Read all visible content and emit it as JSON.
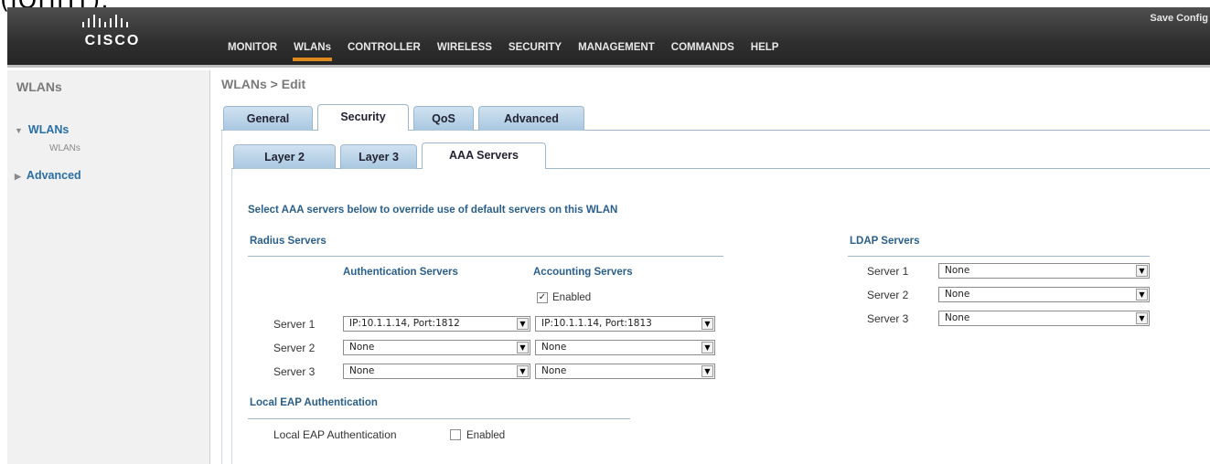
{
  "fragment_text": "(IOHHT).",
  "header": {
    "logo_word": "CISCO",
    "save_link": "Save Config",
    "nav": [
      "MONITOR",
      "WLANs",
      "CONTROLLER",
      "WIRELESS",
      "SECURITY",
      "MANAGEMENT",
      "COMMANDS",
      "HELP"
    ],
    "active_nav": "WLANs"
  },
  "sidebar": {
    "title": "WLANs",
    "items": [
      {
        "label": "WLANs",
        "expanded": true
      },
      {
        "label": "Advanced",
        "expanded": false
      }
    ],
    "sub_items": [
      "WLANs"
    ]
  },
  "page": {
    "title": "WLANs > Edit",
    "tabs": [
      "General",
      "Security",
      "QoS",
      "Advanced"
    ],
    "active_tab": "Security",
    "sub_tabs": [
      "Layer 2",
      "Layer 3",
      "AAA Servers"
    ],
    "active_sub_tab": "AAA Servers",
    "instruction": "Select AAA servers below to override use of default servers on this WLAN"
  },
  "radius": {
    "title": "Radius Servers",
    "auth_header": "Authentication Servers",
    "acct_header": "Accounting Servers",
    "acct_enabled_label": "Enabled",
    "acct_enabled": true,
    "servers": [
      {
        "label": "Server 1",
        "auth": "IP:10.1.1.14, Port:1812",
        "acct": "IP:10.1.1.14, Port:1813"
      },
      {
        "label": "Server 2",
        "auth": "None",
        "acct": "None"
      },
      {
        "label": "Server 3",
        "auth": "None",
        "acct": "None"
      }
    ]
  },
  "local_eap": {
    "title": "Local EAP Authentication",
    "label": "Local EAP Authentication",
    "enabled_label": "Enabled",
    "enabled": false
  },
  "ldap": {
    "title": "LDAP Servers",
    "servers": [
      {
        "label": "Server 1",
        "value": "None"
      },
      {
        "label": "Server 2",
        "value": "None"
      },
      {
        "label": "Server 3",
        "value": "None"
      }
    ]
  },
  "icons": {
    "dropdown": "chevron-down-icon",
    "expanded": "triangle-down-icon",
    "collapsed": "triangle-right-icon",
    "check": "check-icon"
  },
  "colors": {
    "header_bg": "#2f2f2f",
    "active_nav_underline": "#e08a1e",
    "tab_bg": "#a9c7e0",
    "section_text": "#2a5f8c",
    "sidebar_link": "#2a6ea6"
  }
}
